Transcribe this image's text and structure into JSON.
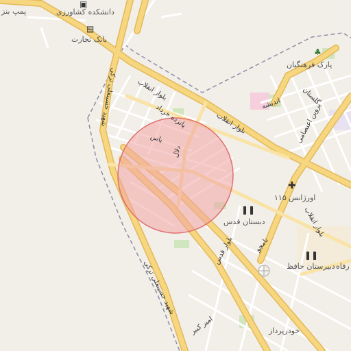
{
  "colors": {
    "land": "#f2efe9",
    "major_road": "#f7d680",
    "major_road_casing": "#e3b85a",
    "minor_road": "#ffffff",
    "minor_road_casing": "#d8d4cc",
    "boundary": "#8e8ea6",
    "park": "#cfe6bf",
    "circle_fill": "#f0a4a4",
    "circle_stroke": "#e07070"
  },
  "labels": {
    "pump": "پمپ بنز",
    "agri_university": "دانشکده کشاورزی",
    "tejarat_bank": "بانک تجارت",
    "enghelab_blvd_1": "بلوار انقلاب",
    "enghelab_blvd_2": "بلوار انقلاب",
    "enghelab_blvd_3": "بلوار انقلاب",
    "cultural_park": "پارک فرهنگیان",
    "golestan": "گلستان",
    "andisheh": "اندیشه",
    "parvin_etesami": "پروین اعتصامی",
    "15_khordad": "پانزده خرداد",
    "yas": "یاس",
    "delal": "دلال",
    "shahid_hassan_turki_1": "شهید حسینعلی ترکی",
    "shahid_hassan_turki_2": "شهید حسینعلی ترکی",
    "emergency_115": "اورژانس ۱۱۵",
    "quds_school": "دبستان قدس",
    "qods_blvd": "بلوار قدس",
    "nameh": "نامجو",
    "hafez_high_school": "دبیرستان حافظ",
    "rafah": "رفاه",
    "amir_kabir": "امیر کبیر",
    "khodropardaz": "خودرپرداز"
  },
  "icons": {
    "university": "university-building-icon",
    "bank": "bank-icon",
    "park": "tree-icon",
    "hospital": "hospital-cross-icon",
    "school": "school-icon",
    "high_school": "school-icon",
    "viewpoint": "viewpoint-icon"
  }
}
